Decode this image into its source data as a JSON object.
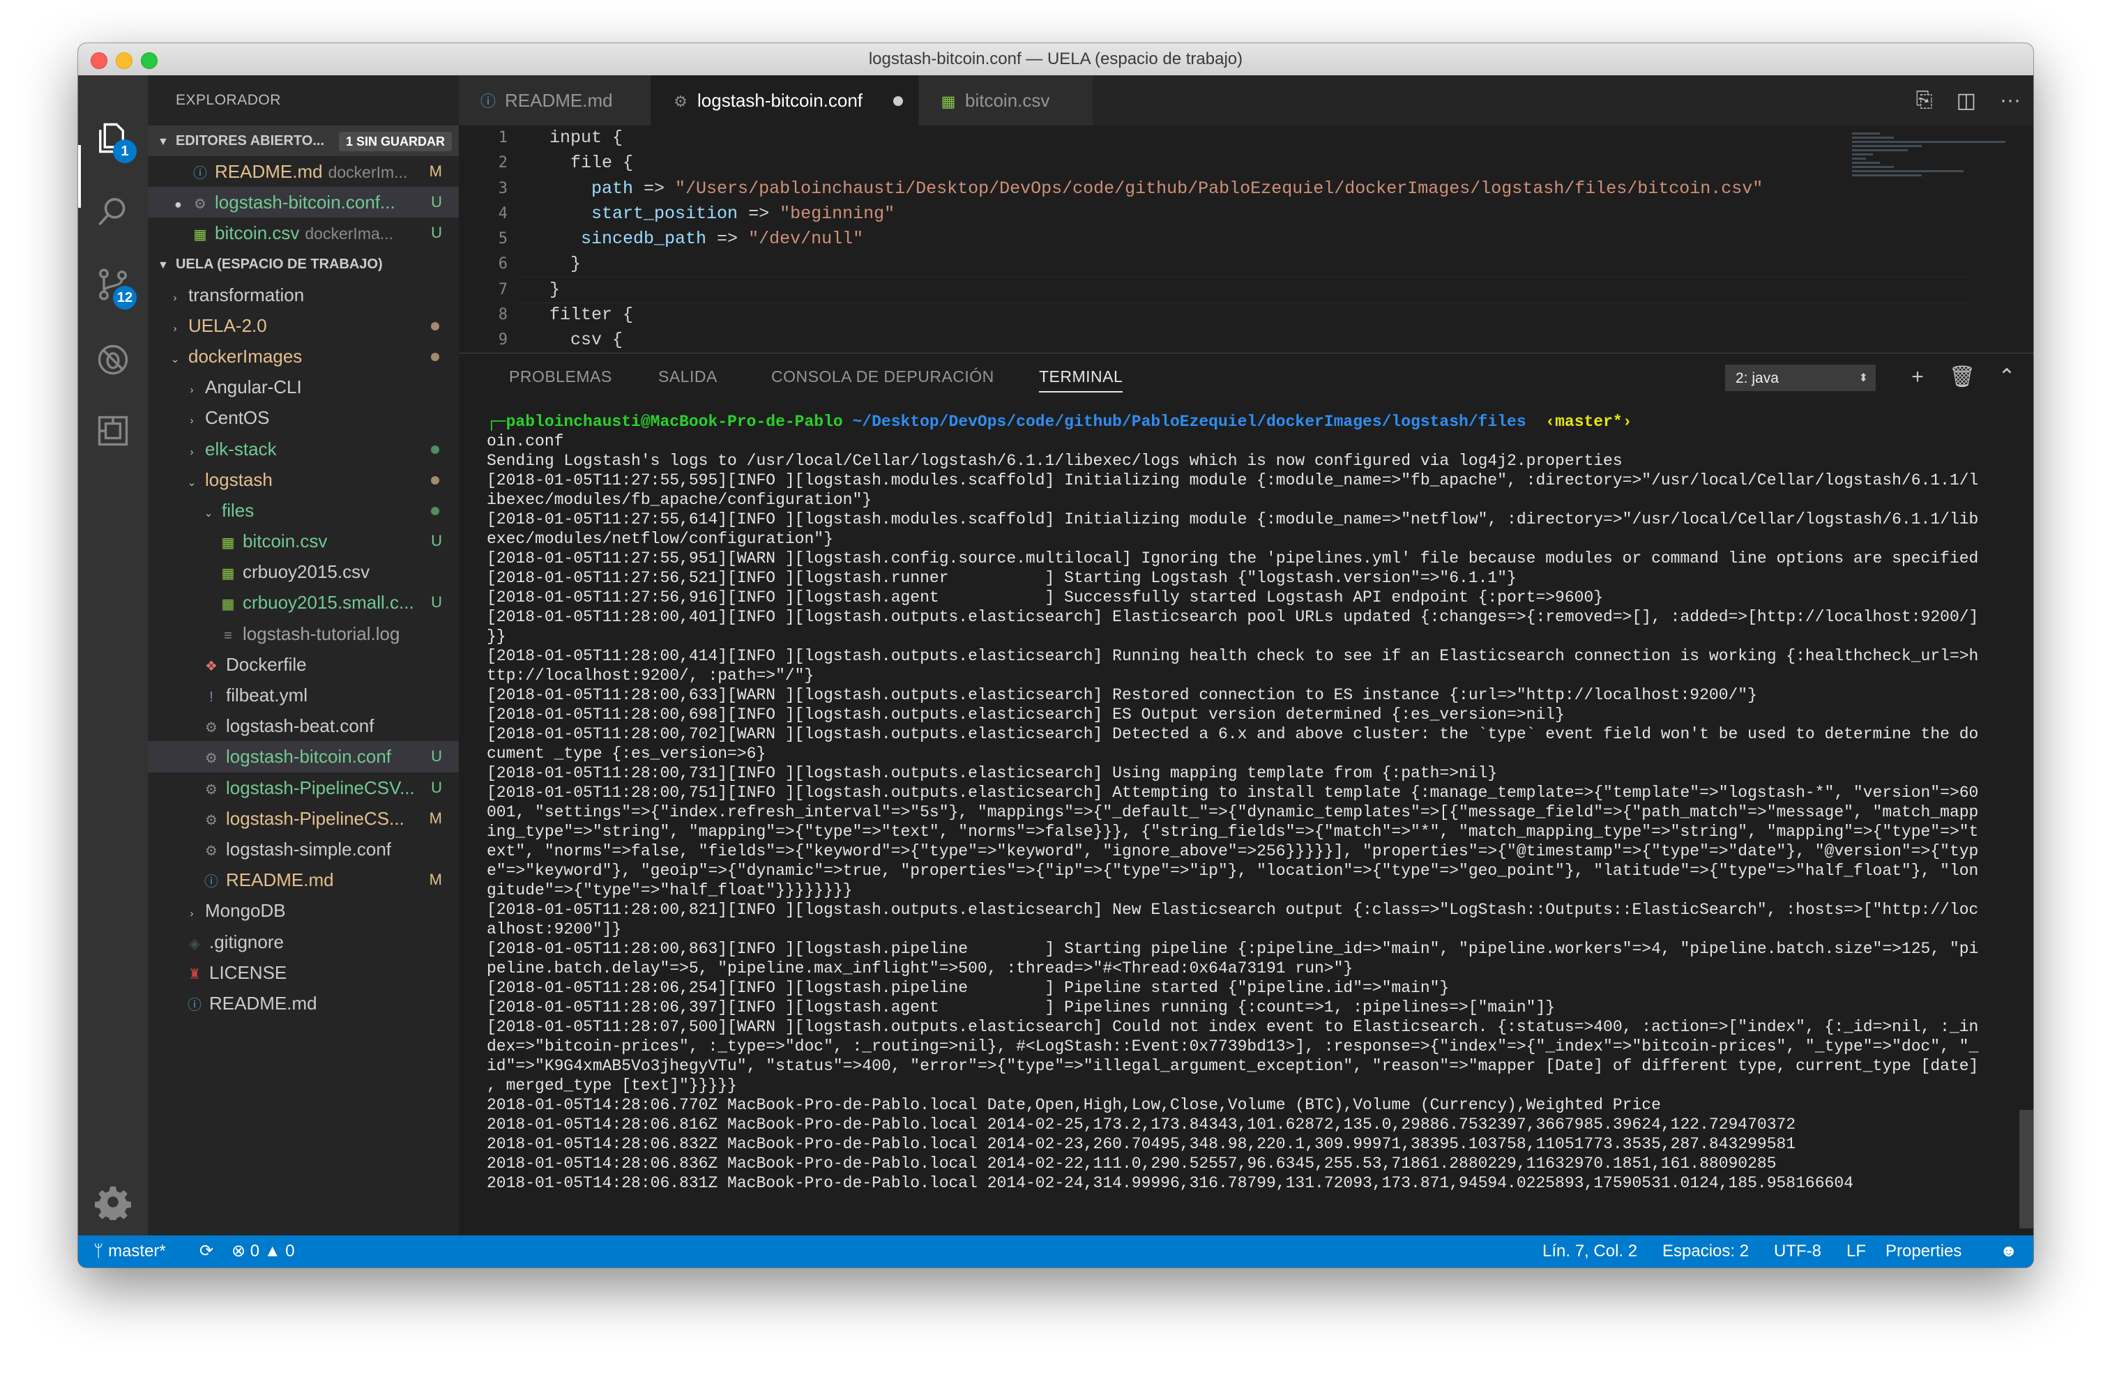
{
  "window": {
    "title": "logstash-bitcoin.conf — UELA (espacio de trabajo)"
  },
  "activity_bar": {
    "items": [
      {
        "name": "explorer-icon",
        "badge": "1"
      },
      {
        "name": "search-icon",
        "badge": ""
      },
      {
        "name": "source-control-icon",
        "badge": "12"
      },
      {
        "name": "debug-icon",
        "badge": ""
      },
      {
        "name": "extensions-icon",
        "badge": ""
      }
    ],
    "settings": "gear-icon"
  },
  "sidebar": {
    "title": "EXPLORADOR",
    "open_editors": {
      "label": "EDITORES ABIERTO...",
      "badge": "1 SIN GUARDAR",
      "items": [
        {
          "icon": "ⓘ",
          "name": "README.md",
          "desc": "dockerIm...",
          "status": "M",
          "color": "#e2c08d",
          "icon_color": "#519aba",
          "dirty": false
        },
        {
          "icon": "⚙",
          "name": "logstash-bitcoin.conf...",
          "desc": "",
          "status": "U",
          "color": "#73c991",
          "icon_color": "#8b8b8b",
          "dirty": true
        },
        {
          "icon": "▦",
          "name": "bitcoin.csv",
          "desc": "dockerIma...",
          "status": "U",
          "color": "#73c991",
          "icon_color": "#89c84b",
          "dirty": false
        }
      ]
    },
    "workspace": {
      "label": "UELA (ESPACIO DE TRABAJO)",
      "items": [
        {
          "level": 0,
          "twisty": "›",
          "name": "transformation",
          "color": "#cccccc",
          "status": "",
          "dot": ""
        },
        {
          "level": 0,
          "twisty": "›",
          "name": "UELA-2.0",
          "color": "#e2c08d",
          "status": "",
          "dot": "#a08c6a"
        },
        {
          "level": 0,
          "twisty": "⌄",
          "name": "dockerImages",
          "color": "#e2c08d",
          "status": "",
          "dot": "#a08c6a"
        },
        {
          "level": 1,
          "twisty": "›",
          "name": "Angular-CLI",
          "color": "#cccccc",
          "status": "",
          "dot": ""
        },
        {
          "level": 1,
          "twisty": "›",
          "name": "CentOS",
          "color": "#cccccc",
          "status": "",
          "dot": ""
        },
        {
          "level": 1,
          "twisty": "›",
          "name": "elk-stack",
          "color": "#73c991",
          "status": "",
          "dot": "#4f8e5e"
        },
        {
          "level": 1,
          "twisty": "⌄",
          "name": "logstash",
          "color": "#e2c08d",
          "status": "",
          "dot": "#a08c6a"
        },
        {
          "level": 2,
          "twisty": "⌄",
          "name": "files",
          "color": "#73c991",
          "status": "",
          "dot": "#4f8e5e"
        },
        {
          "level": 3,
          "icon": "▦",
          "icon_color": "#89c84b",
          "name": "bitcoin.csv",
          "color": "#73c991",
          "status": "U",
          "dot": ""
        },
        {
          "level": 3,
          "icon": "▦",
          "icon_color": "#89c84b",
          "name": "crbuoy2015.csv",
          "color": "#cccccc",
          "status": "",
          "dot": ""
        },
        {
          "level": 3,
          "icon": "▦",
          "icon_color": "#89c84b",
          "name": "crbuoy2015.small.c...",
          "color": "#73c991",
          "status": "U",
          "dot": ""
        },
        {
          "level": 3,
          "icon": "≡",
          "icon_color": "#8b8b8b",
          "name": "logstash-tutorial.log",
          "color": "#a0a0a0",
          "status": "",
          "dot": ""
        },
        {
          "level": 2,
          "icon": "❖",
          "icon_color": "#e37373",
          "name": "Dockerfile",
          "color": "#cccccc",
          "status": "",
          "dot": ""
        },
        {
          "level": 2,
          "icon": "!",
          "icon_color": "#a074c4",
          "name": "filbeat.yml",
          "color": "#cccccc",
          "status": "",
          "dot": ""
        },
        {
          "level": 2,
          "icon": "⚙",
          "icon_color": "#8b8b8b",
          "name": "logstash-beat.conf",
          "color": "#cccccc",
          "status": "",
          "dot": ""
        },
        {
          "level": 2,
          "icon": "⚙",
          "icon_color": "#8b8b8b",
          "name": "logstash-bitcoin.conf",
          "color": "#73c991",
          "status": "U",
          "dot": "",
          "selected": true
        },
        {
          "level": 2,
          "icon": "⚙",
          "icon_color": "#8b8b8b",
          "name": "logstash-PipelineCSV...",
          "color": "#73c991",
          "status": "U",
          "dot": ""
        },
        {
          "level": 2,
          "icon": "⚙",
          "icon_color": "#8b8b8b",
          "name": "logstash-PipelineCS...",
          "color": "#e2c08d",
          "status": "M",
          "dot": ""
        },
        {
          "level": 2,
          "icon": "⚙",
          "icon_color": "#8b8b8b",
          "name": "logstash-simple.conf",
          "color": "#cccccc",
          "status": "",
          "dot": ""
        },
        {
          "level": 2,
          "icon": "ⓘ",
          "icon_color": "#519aba",
          "name": "README.md",
          "color": "#e2c08d",
          "status": "M",
          "dot": ""
        },
        {
          "level": 1,
          "twisty": "›",
          "name": "MongoDB",
          "color": "#cccccc",
          "status": "",
          "dot": ""
        },
        {
          "level": 1,
          "icon": "◈",
          "icon_color": "#41535b",
          "name": ".gitignore",
          "color": "#cccccc",
          "status": "",
          "dot": ""
        },
        {
          "level": 1,
          "icon": "♜",
          "icon_color": "#cc3e44",
          "name": "LICENSE",
          "color": "#cccccc",
          "status": "",
          "dot": ""
        },
        {
          "level": 1,
          "icon": "ⓘ",
          "icon_color": "#519aba",
          "name": "README.md",
          "color": "#cccccc",
          "status": "",
          "dot": ""
        }
      ]
    }
  },
  "tabs": [
    {
      "icon": "ⓘ",
      "icon_color": "#519aba",
      "label": "README.md",
      "active": false,
      "dirty": false
    },
    {
      "icon": "⚙",
      "icon_color": "#8b8b8b",
      "label": "logstash-bitcoin.conf",
      "active": true,
      "dirty": true
    },
    {
      "icon": "▦",
      "icon_color": "#89c84b",
      "label": "bitcoin.csv",
      "active": false,
      "dirty": false
    }
  ],
  "editor": {
    "line_numbers": [
      "1",
      "2",
      "3",
      "4",
      "5",
      "6",
      "7",
      "8",
      "9"
    ],
    "lines": [
      [
        {
          "t": "input ",
          "c": "pl"
        },
        {
          "t": "{",
          "c": "pl"
        }
      ],
      [
        {
          "t": "  file {",
          "c": "pl"
        }
      ],
      [
        {
          "t": "    ",
          "c": "pl"
        },
        {
          "t": "path",
          "c": "kw"
        },
        {
          "t": " => ",
          "c": "pl"
        },
        {
          "t": "\"/Users/pabloinchausti/Desktop/DevOps/code/github/PabloEzequiel/dockerImages/logstash/files/bitcoin.csv\"",
          "c": "sv"
        }
      ],
      [
        {
          "t": "    ",
          "c": "pl"
        },
        {
          "t": "start_position",
          "c": "kw"
        },
        {
          "t": " => ",
          "c": "pl"
        },
        {
          "t": "\"beginning\"",
          "c": "sv"
        }
      ],
      [
        {
          "t": "   ",
          "c": "pl"
        },
        {
          "t": "sincedb_path",
          "c": "kw"
        },
        {
          "t": " => ",
          "c": "pl"
        },
        {
          "t": "\"/dev/null\"",
          "c": "sv"
        }
      ],
      [
        {
          "t": "  }",
          "c": "pl"
        }
      ],
      [
        {
          "t": "}",
          "c": "pl"
        }
      ],
      [
        {
          "t": "filter {",
          "c": "pl"
        }
      ],
      [
        {
          "t": "  csv {",
          "c": "pl"
        }
      ]
    ]
  },
  "panel": {
    "tabs": [
      "PROBLEMAS",
      "SALIDA",
      "CONSOLA DE DEPURACIÓN",
      "TERMINAL"
    ],
    "active_tab": "TERMINAL",
    "terminal_select": "2: java",
    "prompt": {
      "user": "┌─pabloinchausti@MacBook-Pro-de-Pablo",
      "path": "~/Desktop/DevOps/code/github/PabloEzequiel/dockerImages/logstash/files",
      "branch": "‹master*›"
    },
    "terminal_lines": [
      "oin.conf",
      "Sending Logstash's logs to /usr/local/Cellar/logstash/6.1.1/libexec/logs which is now configured via log4j2.properties",
      "[2018-01-05T11:27:55,595][INFO ][logstash.modules.scaffold] Initializing module {:module_name=>\"fb_apache\", :directory=>\"/usr/local/Cellar/logstash/6.1.1/l",
      "ibexec/modules/fb_apache/configuration\"}",
      "[2018-01-05T11:27:55,614][INFO ][logstash.modules.scaffold] Initializing module {:module_name=>\"netflow\", :directory=>\"/usr/local/Cellar/logstash/6.1.1/lib",
      "exec/modules/netflow/configuration\"}",
      "[2018-01-05T11:27:55,951][WARN ][logstash.config.source.multilocal] Ignoring the 'pipelines.yml' file because modules or command line options are specified",
      "[2018-01-05T11:27:56,521][INFO ][logstash.runner          ] Starting Logstash {\"logstash.version\"=>\"6.1.1\"}",
      "[2018-01-05T11:27:56,916][INFO ][logstash.agent           ] Successfully started Logstash API endpoint {:port=>9600}",
      "[2018-01-05T11:28:00,401][INFO ][logstash.outputs.elasticsearch] Elasticsearch pool URLs updated {:changes=>{:removed=>[], :added=>[http://localhost:9200/]",
      "}}",
      "[2018-01-05T11:28:00,414][INFO ][logstash.outputs.elasticsearch] Running health check to see if an Elasticsearch connection is working {:healthcheck_url=>h",
      "ttp://localhost:9200/, :path=>\"/\"}",
      "[2018-01-05T11:28:00,633][WARN ][logstash.outputs.elasticsearch] Restored connection to ES instance {:url=>\"http://localhost:9200/\"}",
      "[2018-01-05T11:28:00,698][INFO ][logstash.outputs.elasticsearch] ES Output version determined {:es_version=>nil}",
      "[2018-01-05T11:28:00,702][WARN ][logstash.outputs.elasticsearch] Detected a 6.x and above cluster: the `type` event field won't be used to determine the do",
      "cument _type {:es_version=>6}",
      "[2018-01-05T11:28:00,731][INFO ][logstash.outputs.elasticsearch] Using mapping template from {:path=>nil}",
      "[2018-01-05T11:28:00,751][INFO ][logstash.outputs.elasticsearch] Attempting to install template {:manage_template=>{\"template\"=>\"logstash-*\", \"version\"=>60",
      "001, \"settings\"=>{\"index.refresh_interval\"=>\"5s\"}, \"mappings\"=>{\"_default_\"=>{\"dynamic_templates\"=>[{\"message_field\"=>{\"path_match\"=>\"message\", \"match_mapp",
      "ing_type\"=>\"string\", \"mapping\"=>{\"type\"=>\"text\", \"norms\"=>false}}}, {\"string_fields\"=>{\"match\"=>\"*\", \"match_mapping_type\"=>\"string\", \"mapping\"=>{\"type\"=>\"t",
      "ext\", \"norms\"=>false, \"fields\"=>{\"keyword\"=>{\"type\"=>\"keyword\", \"ignore_above\"=>256}}}}}], \"properties\"=>{\"@timestamp\"=>{\"type\"=>\"date\"}, \"@version\"=>{\"typ",
      "e\"=>\"keyword\"}, \"geoip\"=>{\"dynamic\"=>true, \"properties\"=>{\"ip\"=>{\"type\"=>\"ip\"}, \"location\"=>{\"type\"=>\"geo_point\"}, \"latitude\"=>{\"type\"=>\"half_float\"}, \"lon",
      "gitude\"=>{\"type\"=>\"half_float\"}}}}}}}}",
      "[2018-01-05T11:28:00,821][INFO ][logstash.outputs.elasticsearch] New Elasticsearch output {:class=>\"LogStash::Outputs::ElasticSearch\", :hosts=>[\"http://loc",
      "alhost:9200\"]}",
      "[2018-01-05T11:28:00,863][INFO ][logstash.pipeline        ] Starting pipeline {:pipeline_id=>\"main\", \"pipeline.workers\"=>4, \"pipeline.batch.size\"=>125, \"pi",
      "peline.batch.delay\"=>5, \"pipeline.max_inflight\"=>500, :thread=>\"#<Thread:0x64a73191 run>\"}",
      "[2018-01-05T11:28:06,254][INFO ][logstash.pipeline        ] Pipeline started {\"pipeline.id\"=>\"main\"}",
      "[2018-01-05T11:28:06,397][INFO ][logstash.agent           ] Pipelines running {:count=>1, :pipelines=>[\"main\"]}",
      "[2018-01-05T11:28:07,500][WARN ][logstash.outputs.elasticsearch] Could not index event to Elasticsearch. {:status=>400, :action=>[\"index\", {:_id=>nil, :_in",
      "dex=>\"bitcoin-prices\", :_type=>\"doc\", :_routing=>nil}, #<LogStash::Event:0x7739bd13>], :response=>{\"index\"=>{\"_index\"=>\"bitcoin-prices\", \"_type\"=>\"doc\", \"_",
      "id\"=>\"K9G4xmAB5Vo3jhegyVTu\", \"status\"=>400, \"error\"=>{\"type\"=>\"illegal_argument_exception\", \"reason\"=>\"mapper [Date] of different type, current_type [date]",
      ", merged_type [text]\"}}}}}",
      "2018-01-05T14:28:06.770Z MacBook-Pro-de-Pablo.local Date,Open,High,Low,Close,Volume (BTC),Volume (Currency),Weighted Price",
      "2018-01-05T14:28:06.816Z MacBook-Pro-de-Pablo.local 2014-02-25,173.2,173.84343,101.62872,135.0,29886.7532397,3667985.39624,122.729470372",
      "2018-01-05T14:28:06.832Z MacBook-Pro-de-Pablo.local 2014-02-23,260.70495,348.98,220.1,309.99971,38395.103758,11051773.3535,287.843299581",
      "2018-01-05T14:28:06.836Z MacBook-Pro-de-Pablo.local 2014-02-22,111.0,290.52557,96.6345,255.53,71861.2880229,11632970.1851,161.88090285",
      "2018-01-05T14:28:06.831Z MacBook-Pro-de-Pablo.local 2014-02-24,314.99996,316.78799,131.72093,173.871,94594.0225893,17590531.0124,185.958166604"
    ]
  },
  "statusbar": {
    "branch": "master*",
    "errors": "0",
    "warnings": "0",
    "position": "Lín. 7, Col. 2",
    "spaces": "Espacios: 2",
    "encoding": "UTF-8",
    "eol": "LF",
    "language": "Properties"
  }
}
